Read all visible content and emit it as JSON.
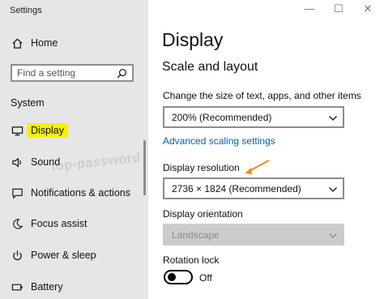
{
  "window": {
    "title": "Settings",
    "controls": {
      "minimize": "—",
      "maximize": "☐",
      "close": "✕"
    }
  },
  "sidebar": {
    "home": {
      "label": "Home",
      "icon": "home-icon"
    },
    "search": {
      "placeholder": "Find a setting",
      "icon": "search-icon"
    },
    "section_title": "System",
    "items": [
      {
        "label": "Display",
        "icon": "monitor-icon",
        "selected": true
      },
      {
        "label": "Sound",
        "icon": "speaker-icon"
      },
      {
        "label": "Notifications & actions",
        "icon": "notification-icon"
      },
      {
        "label": "Focus assist",
        "icon": "moon-icon"
      },
      {
        "label": "Power & sleep",
        "icon": "power-icon"
      },
      {
        "label": "Battery",
        "icon": "battery-icon"
      }
    ]
  },
  "main": {
    "title": "Display",
    "section_title": "Scale and layout",
    "scale": {
      "label": "Change the size of text, apps, and other items",
      "value": "200% (Recommended)"
    },
    "advanced_link": "Advanced scaling settings",
    "resolution": {
      "label": "Display resolution",
      "value": "2736 × 1824 (Recommended)"
    },
    "orientation": {
      "label": "Display orientation",
      "value": "Landscape",
      "disabled": true
    },
    "rotation_lock": {
      "label": "Rotation lock",
      "state": "Off"
    }
  },
  "overlay": {
    "watermark": "top-password",
    "accent_color": "#f5f100",
    "arrow_color": "#f08a1c"
  }
}
